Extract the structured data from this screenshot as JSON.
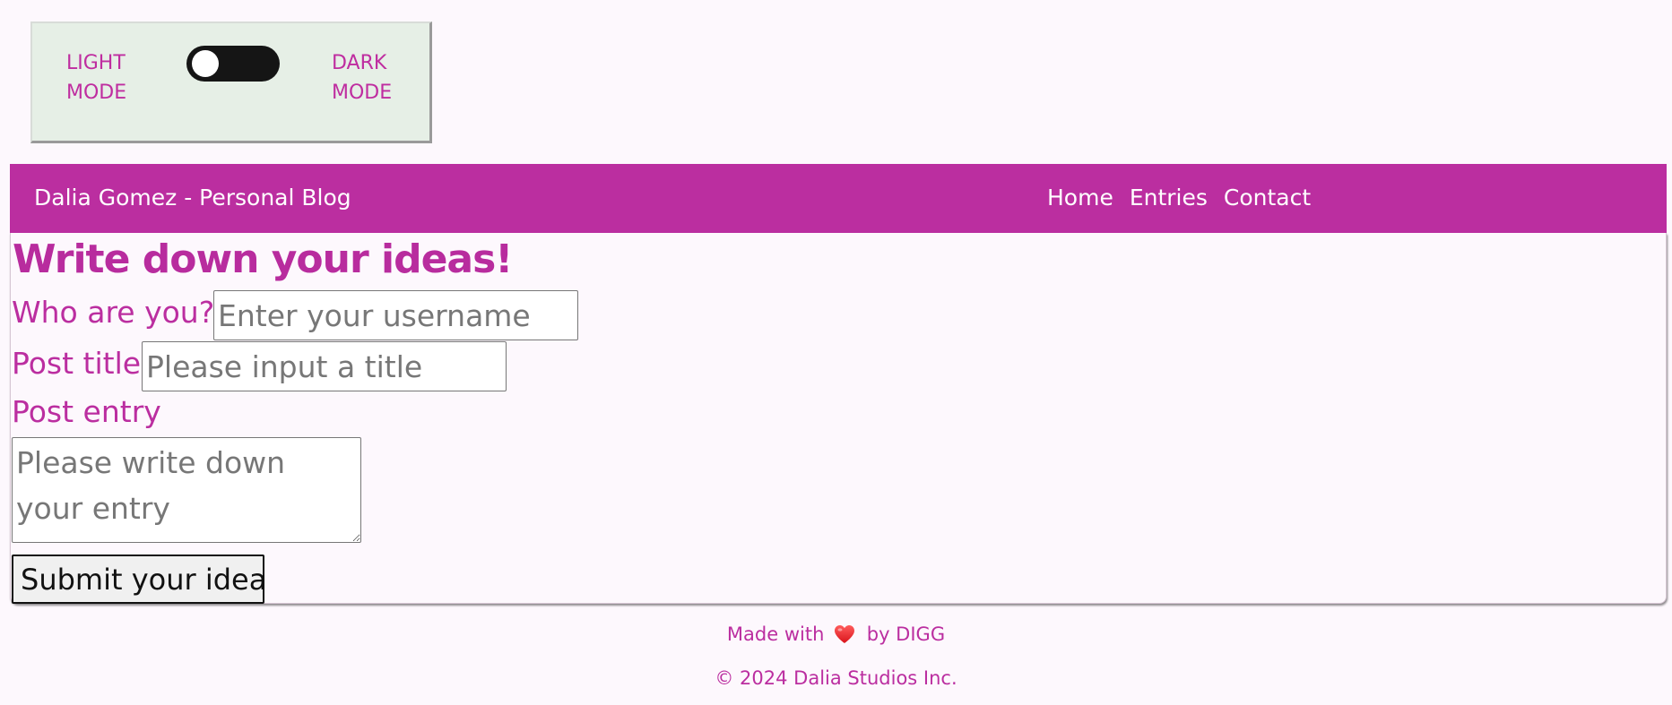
{
  "mode_toggle": {
    "light_label": "Light Mode",
    "dark_label": "Dark Mode",
    "state": "light"
  },
  "navbar": {
    "brand": "Dalia Gomez - Personal Blog",
    "links": [
      "Home",
      "Entries",
      "Contact"
    ]
  },
  "form": {
    "heading": "Write down your ideas!",
    "username": {
      "label": "Who are you?",
      "placeholder": "Enter your username",
      "value": ""
    },
    "title": {
      "label": "Post title",
      "placeholder": "Please input a title",
      "value": ""
    },
    "entry": {
      "label": "Post entry",
      "placeholder": "Please write down your entry",
      "value": ""
    },
    "submit_label": "Submit your idea"
  },
  "footer": {
    "made_prefix": "Made with",
    "made_suffix": "by DIGG",
    "heart_icon": "heart-icon",
    "copyright": "© 2024 Dalia Studios Inc."
  },
  "colors": {
    "accent": "#bb2ea0",
    "background": "#fdf8fd",
    "toggle_box": "#e6efe6",
    "heart": "#e8262c"
  }
}
